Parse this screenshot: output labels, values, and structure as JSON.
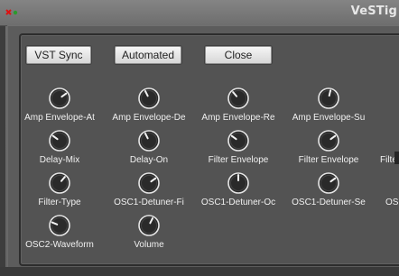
{
  "window": {
    "title": "VeSTig"
  },
  "colors": {
    "panel": "#5c5c5c",
    "inner": "#535353",
    "knob_body": "#2a2a2a",
    "knob_ring": "#e6e6e6",
    "label": "#f0f0f0",
    "button_face": "#e6e6e6"
  },
  "buttons": [
    {
      "label": "VST Sync"
    },
    {
      "label": "Automated"
    },
    {
      "label": "Close"
    }
  ],
  "knobs": [
    {
      "label": "Amp Envelope-At",
      "value": 0.7
    },
    {
      "label": "Amp Envelope-De",
      "value": 0.4
    },
    {
      "label": "Amp Envelope-Re",
      "value": 0.35
    },
    {
      "label": "Amp Envelope-Su",
      "value": 0.55
    },
    {
      "label": "Delay-Mix",
      "value": 0.3
    },
    {
      "label": "Delay-On",
      "value": 0.4
    },
    {
      "label": "Filter Envelope",
      "value": 0.3
    },
    {
      "label": "Filter Envelope",
      "value": 0.7
    },
    {
      "label": "Filte",
      "value": 0.5
    },
    {
      "label": "Filter-Type",
      "value": 0.65
    },
    {
      "label": "OSC1-Detuner-Fi",
      "value": 0.7
    },
    {
      "label": "OSC1-Detuner-Oc",
      "value": 0.5
    },
    {
      "label": "OSC1-Detuner-Se",
      "value": 0.7
    },
    {
      "label": "OS",
      "value": 0.5
    },
    {
      "label": "OSC2-Waveform",
      "value": 0.25
    },
    {
      "label": "Volume",
      "value": 0.6
    }
  ]
}
